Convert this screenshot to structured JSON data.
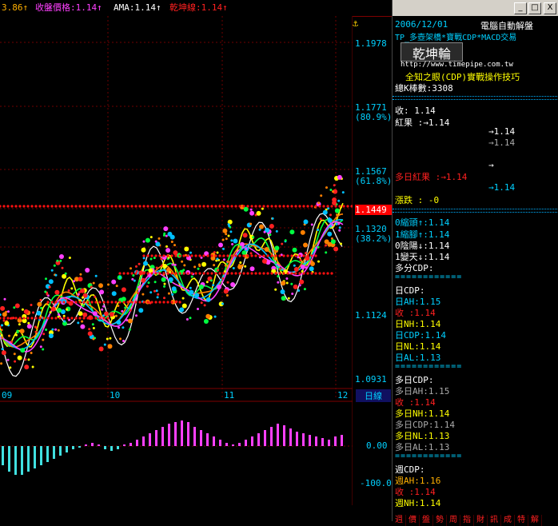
{
  "window": {
    "date": "2006/12/01",
    "title": "電腦自動解盤",
    "btn_min": "_",
    "btn_max": "□",
    "btn_close": "X"
  },
  "topbar": {
    "partial_value": "3.86↑",
    "price_label": "收盤價格:1.14↑",
    "ama_label": "AMA:1.14↑",
    "qkl_label": "乾坤線:1.14↑"
  },
  "chart_icon": "⚓",
  "axis": {
    "y_labels": [
      "1.1978",
      "1.1771",
      "(80.9%)",
      "1.1567",
      "(61.8%)",
      "1.1449",
      "1.1320",
      "(38.2%)",
      "1.1124",
      "1.0931"
    ],
    "x_labels": [
      "09",
      "10",
      "11",
      "12"
    ],
    "period": "日線",
    "macd_labels": [
      "0.00",
      "-100.0"
    ]
  },
  "panel": {
    "strategy": "TP_多壺架橋*寶戰CDP*MACD交易",
    "logo": "乾坤輪",
    "url": "http://www.timepipe.com.tw",
    "subtitle": "全知之眼(CDP)實戰操作技巧",
    "total_bars": "總K棒數:3308",
    "close_line": "收:  1.14",
    "red_result": "紅果    :→1.14",
    "arrow1": "→1.14",
    "arrow2": "→1.14",
    "arrow3": "→",
    "multi_red": "多日紅果  :→1.14",
    "arrow4": "→1.14",
    "change": "漲跌  : -0",
    "zero_head": "0縮頭↑:1.14",
    "one_head": "1縮腳↑:1.14",
    "zero_yin": "0陰陽↓:1.14",
    "one_day": "1變天↓:1.14",
    "multi_cdp": "多分CDP:",
    "sep": "============",
    "day_cdp": "日CDP:",
    "day_ah": "日AH:1.15",
    "day_close": "收  :1.14",
    "day_nh": "日NH:1.14",
    "day_cdpv": "日CDP:1.14",
    "day_nl": "日NL:1.14",
    "day_al": "日AL:1.13",
    "mday_cdp": "多日CDP:",
    "mday_ah": "多日AH:1.15",
    "mday_close": "收  :1.14",
    "mday_nh": "多日NH:1.14",
    "mday_cdpv": "多日CDP:1.14",
    "mday_nl": "多日NL:1.13",
    "mday_al": "多日AL:1.13",
    "week_cdp": "週CDP:",
    "week_ah": "週AH:1.16",
    "week_close": "收  :1.14",
    "week_nh": "週NH:1.14"
  },
  "bottom_tabs": [
    "週",
    "價",
    "盤",
    "勢",
    "周",
    "指",
    "財",
    "訊",
    "成",
    "特",
    "解"
  ],
  "colors": {
    "cyan": "#00d0ff",
    "red": "#ff2020",
    "yellow": "#ffff00",
    "magenta": "#ff40ff",
    "white": "#ffffff"
  },
  "chart_data": {
    "type": "line",
    "macd_values": [
      -0.6,
      -0.8,
      -0.9,
      -0.9,
      -0.8,
      -0.7,
      -0.6,
      -0.5,
      -0.4,
      -0.3,
      -0.2,
      -0.1,
      -0.05,
      0.05,
      0.1,
      0.05,
      -0.1,
      -0.15,
      -0.1,
      0.05,
      0.1,
      0.2,
      0.3,
      0.4,
      0.5,
      0.6,
      0.7,
      0.75,
      0.8,
      0.75,
      0.6,
      0.5,
      0.4,
      0.3,
      0.2,
      0.1,
      0.05,
      0.1,
      0.2,
      0.3,
      0.4,
      0.5,
      0.6,
      0.7,
      0.65,
      0.55,
      0.45,
      0.4,
      0.35,
      0.3,
      0.25,
      0.2,
      0.3,
      0.35
    ]
  }
}
